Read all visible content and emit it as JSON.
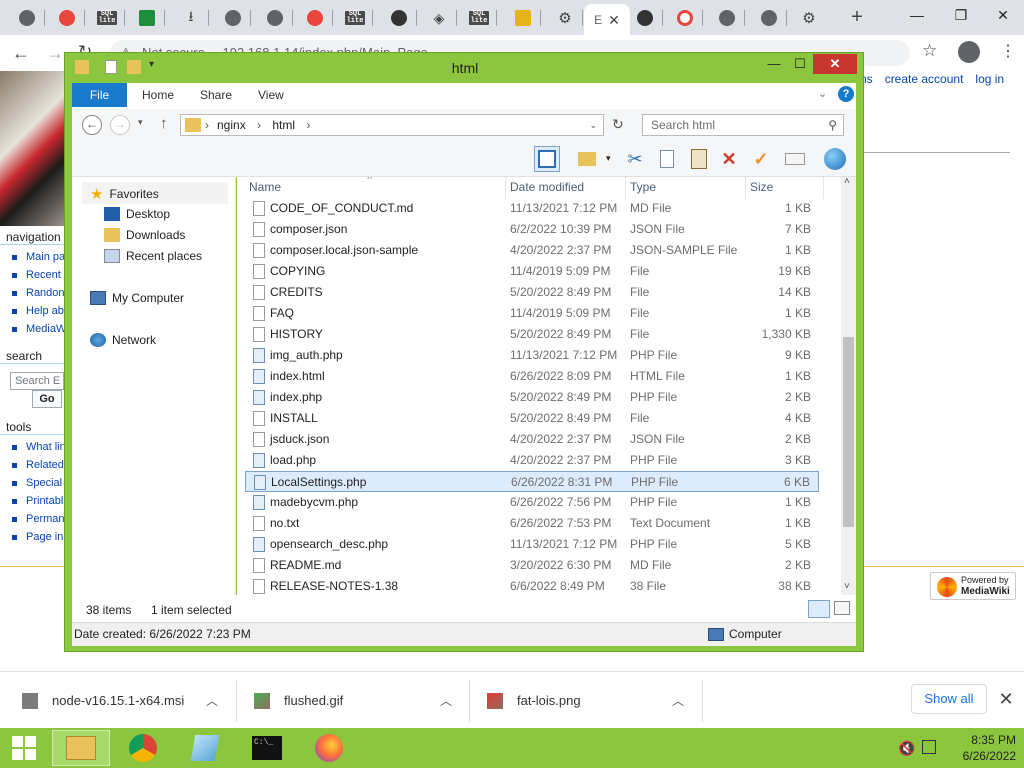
{
  "browser": {
    "active_tab_label": "E",
    "address": "192.168.1.14/index.php/Main_Page",
    "address_security": "Not secure",
    "tab_icons": [
      "chrome-icon",
      "red-app-icon",
      "sql-icon",
      "nginx-icon",
      "download-icon",
      "globe-icon",
      "globe-icon",
      "red-card-icon",
      "sql-icon",
      "github-icon",
      "diamond-icon",
      "sql-icon",
      "folder-icon",
      "gear-icon",
      "pacman-icon",
      "ring-icon",
      "globe-icon",
      "globe-icon",
      "gear-icon"
    ],
    "sql_text": "SQL\nlite"
  },
  "wiki": {
    "top_links": [
      "ns",
      "create account",
      "log in"
    ],
    "navigation": {
      "title": "navigation",
      "items": [
        "Main pa",
        "Recent",
        "Randon",
        "Help ab",
        "MediaWi"
      ]
    },
    "search": {
      "title": "search",
      "placeholder": "Search E",
      "go_label": "Go"
    },
    "tools": {
      "title": "tools",
      "items": [
        "What lin",
        "Related",
        "Special",
        "Printabl",
        "Perman",
        "Page in"
      ]
    },
    "powered_by": {
      "line1": "Powered by",
      "line2": "MediaWiki"
    }
  },
  "explorer": {
    "title": "html",
    "ribbon": {
      "file": "File",
      "tabs": [
        "Home",
        "Share",
        "View"
      ]
    },
    "path": [
      "nginx",
      "html"
    ],
    "search_placeholder": "Search html",
    "nav": {
      "favorites": "Favorites",
      "fav_items": [
        "Desktop",
        "Downloads",
        "Recent places"
      ],
      "computer": "My Computer",
      "network": "Network"
    },
    "columns": {
      "name": "Name",
      "date": "Date modified",
      "type": "Type",
      "size": "Size"
    },
    "files": [
      {
        "name": "CODE_OF_CONDUCT.md",
        "date": "11/13/2021 7:12 PM",
        "type": "MD File",
        "size": "1 KB",
        "kind": "doc"
      },
      {
        "name": "composer.json",
        "date": "6/2/2022 10:39 PM",
        "type": "JSON File",
        "size": "7 KB",
        "kind": "doc"
      },
      {
        "name": "composer.local.json-sample",
        "date": "4/20/2022 2:37 PM",
        "type": "JSON-SAMPLE File",
        "size": "1 KB",
        "kind": "doc"
      },
      {
        "name": "COPYING",
        "date": "11/4/2019 5:09 PM",
        "type": "File",
        "size": "19 KB",
        "kind": "doc"
      },
      {
        "name": "CREDITS",
        "date": "5/20/2022 8:49 PM",
        "type": "File",
        "size": "14 KB",
        "kind": "doc"
      },
      {
        "name": "FAQ",
        "date": "11/4/2019 5:09 PM",
        "type": "File",
        "size": "1 KB",
        "kind": "doc"
      },
      {
        "name": "HISTORY",
        "date": "5/20/2022 8:49 PM",
        "type": "File",
        "size": "1,330 KB",
        "kind": "doc"
      },
      {
        "name": "img_auth.php",
        "date": "11/13/2021 7:12 PM",
        "type": "PHP File",
        "size": "9 KB",
        "kind": "php"
      },
      {
        "name": "index.html",
        "date": "6/26/2022 8:09 PM",
        "type": "HTML File",
        "size": "1 KB",
        "kind": "php"
      },
      {
        "name": "index.php",
        "date": "5/20/2022 8:49 PM",
        "type": "PHP File",
        "size": "2 KB",
        "kind": "php"
      },
      {
        "name": "INSTALL",
        "date": "5/20/2022 8:49 PM",
        "type": "File",
        "size": "4 KB",
        "kind": "doc"
      },
      {
        "name": "jsduck.json",
        "date": "4/20/2022 2:37 PM",
        "type": "JSON File",
        "size": "2 KB",
        "kind": "doc"
      },
      {
        "name": "load.php",
        "date": "4/20/2022 2:37 PM",
        "type": "PHP File",
        "size": "3 KB",
        "kind": "php"
      },
      {
        "name": "LocalSettings.php",
        "date": "6/26/2022 8:31 PM",
        "type": "PHP File",
        "size": "6 KB",
        "kind": "php",
        "selected": true
      },
      {
        "name": "madebycvm.php",
        "date": "6/26/2022 7:56 PM",
        "type": "PHP File",
        "size": "1 KB",
        "kind": "php"
      },
      {
        "name": "no.txt",
        "date": "6/26/2022 7:53 PM",
        "type": "Text Document",
        "size": "1 KB",
        "kind": "doc"
      },
      {
        "name": "opensearch_desc.php",
        "date": "11/13/2021 7:12 PM",
        "type": "PHP File",
        "size": "5 KB",
        "kind": "php"
      },
      {
        "name": "README.md",
        "date": "3/20/2022 6:30 PM",
        "type": "MD File",
        "size": "2 KB",
        "kind": "doc"
      },
      {
        "name": "RELEASE-NOTES-1.38",
        "date": "6/6/2022 8:49 PM",
        "type": "38 File",
        "size": "38 KB",
        "kind": "doc"
      }
    ],
    "item_count": "38 items",
    "selected_count": "1 item selected",
    "status_left": "Date created: 6/26/2022 7:23 PM",
    "status_right": "Computer"
  },
  "downloads": {
    "items": [
      "node-v16.15.1-x64.msi",
      "flushed.gif",
      "fat-lois.png"
    ],
    "show_all": "Show all"
  },
  "taskbar": {
    "time": "8:35 PM",
    "date": "6/26/2022"
  }
}
